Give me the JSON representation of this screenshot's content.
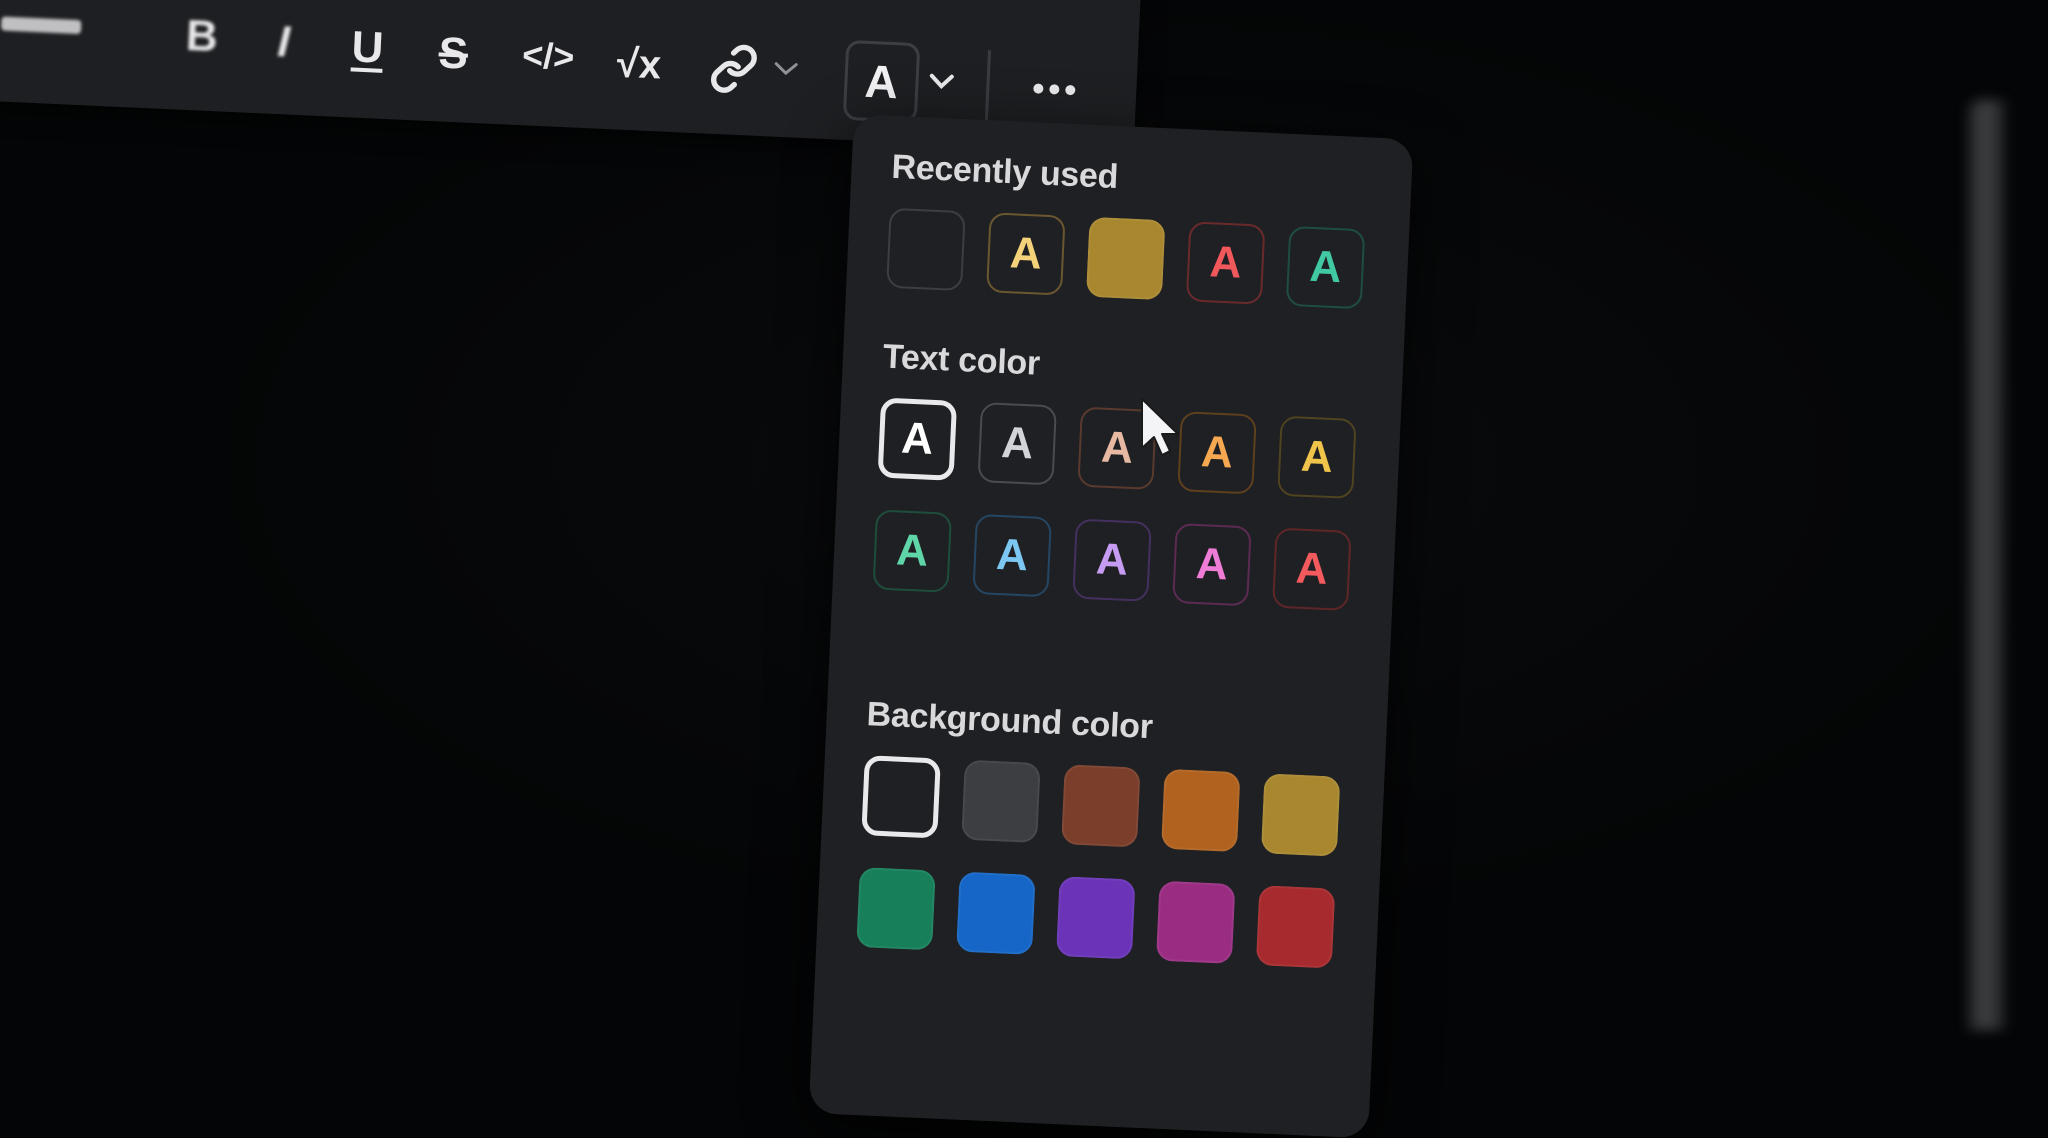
{
  "toolbar": {
    "tools": [
      {
        "name": "bold",
        "label": "B"
      },
      {
        "name": "italic",
        "label": "I"
      },
      {
        "name": "underline",
        "label": "U"
      },
      {
        "name": "strikethrough",
        "label": "S"
      },
      {
        "name": "code",
        "label": "</>"
      },
      {
        "name": "math",
        "label": "√x"
      }
    ],
    "color_button_label": "A",
    "icons": [
      "link-icon",
      "chevron-down-icon",
      "more-icon"
    ]
  },
  "popup": {
    "recent_title": "Recently used",
    "text_title": "Text color",
    "background_title": "Background color",
    "letter": "A",
    "recent": [
      {
        "kind": "empty",
        "border": "#3c3e42"
      },
      {
        "kind": "text",
        "color": "#f4d27a",
        "border": "#6a5730"
      },
      {
        "kind": "fill",
        "fill": "#a8872e"
      },
      {
        "kind": "text",
        "color": "#f0585c",
        "border": "#6a2a2c"
      },
      {
        "kind": "text",
        "color": "#40c9a2",
        "border": "#1f4d40"
      }
    ],
    "text_colors": [
      {
        "name": "default",
        "color": "#ffffff",
        "border": "#e9e9ec",
        "selected": true
      },
      {
        "name": "gray",
        "color": "#d3d4d7",
        "border": "#4a4b50"
      },
      {
        "name": "brown",
        "color": "#e8b9a2",
        "border": "#5a3a2e"
      },
      {
        "name": "orange",
        "color": "#f5a850",
        "border": "#5e3f1e"
      },
      {
        "name": "yellow",
        "color": "#f0c44a",
        "border": "#4f4320"
      },
      {
        "name": "green",
        "color": "#5fd6a8",
        "border": "#1f4d3c"
      },
      {
        "name": "blue",
        "color": "#7cc6f2",
        "border": "#244663"
      },
      {
        "name": "purple",
        "color": "#c69cf2",
        "border": "#43305f"
      },
      {
        "name": "pink",
        "color": "#ef7cd6",
        "border": "#5c2a52"
      },
      {
        "name": "red",
        "color": "#f25a5e",
        "border": "#5e2628"
      }
    ],
    "background_colors": [
      {
        "name": "default",
        "fill": "#1f2023",
        "selected": true
      },
      {
        "name": "gray",
        "fill": "#3c3e42"
      },
      {
        "name": "brown",
        "fill": "#7a3e2a"
      },
      {
        "name": "orange",
        "fill": "#b0621e"
      },
      {
        "name": "yellow",
        "fill": "#a8872e"
      },
      {
        "name": "green",
        "fill": "#17805a"
      },
      {
        "name": "blue",
        "fill": "#1566c6"
      },
      {
        "name": "purple",
        "fill": "#6a33b8"
      },
      {
        "name": "pink",
        "fill": "#9a2d82"
      },
      {
        "name": "red",
        "fill": "#a62a2e"
      }
    ]
  }
}
